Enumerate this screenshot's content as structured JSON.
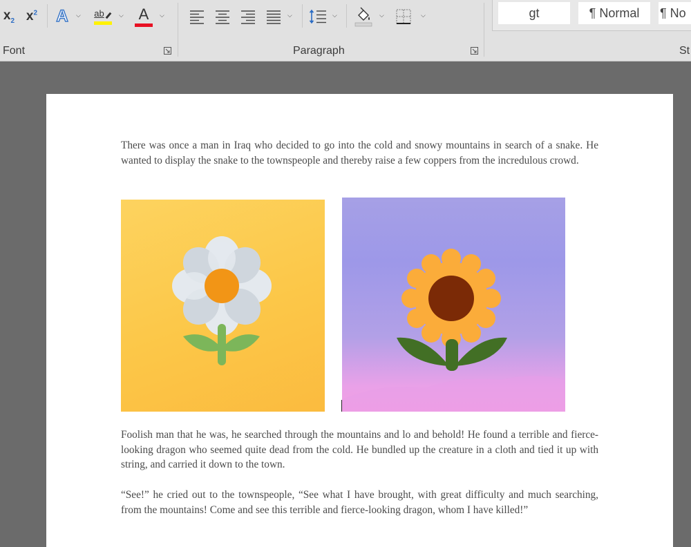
{
  "ribbon": {
    "font_group": {
      "label": "Font",
      "subscript_glyph": "x",
      "subscript_mark": "2",
      "superscript_glyph": "x",
      "superscript_mark": "2",
      "text_effects_glyph": "A",
      "highlight_glyph": "ab",
      "highlight_color": "#fff200",
      "font_color_glyph": "A",
      "font_color": "#e81123"
    },
    "paragraph_group": {
      "label": "Paragraph"
    },
    "styles_group": {
      "gallery": [
        "gt",
        "¶ Normal",
        "¶ No"
      ],
      "label_partial": "St"
    }
  },
  "document": {
    "paragraphs": [
      "There was once a man in Iraq who decided to go into the cold and snowy mountains in search of a snake. He wanted to display the snake to the townspeople and thereby raise a few coppers from the incredulous crowd.",
      "Foolish man that he was, he searched through the mountains and lo and behold! He found a terrible and fierce-looking dragon who seemed quite dead from the cold. He bundled up the creature in a cloth and tied it up with string, and carried it down to the town.",
      "“See!” he cried out to the townspeople, “See what I have brought, with great difficulty and much searching, from the mountains! Come and see this terrible and fierce-looking dragon, whom I have killed!”"
    ],
    "images": [
      {
        "name": "daisy-icon",
        "background": "#fdc94f",
        "petal_color": "#e4e9ee",
        "center_color": "#f29516",
        "leaf_color": "#7cb65a"
      },
      {
        "name": "sunflower-icon",
        "background": "#a29be6",
        "petal_color": "#fbac3a",
        "center_color": "#7b2a06",
        "leaf_color": "#426f25"
      }
    ]
  }
}
